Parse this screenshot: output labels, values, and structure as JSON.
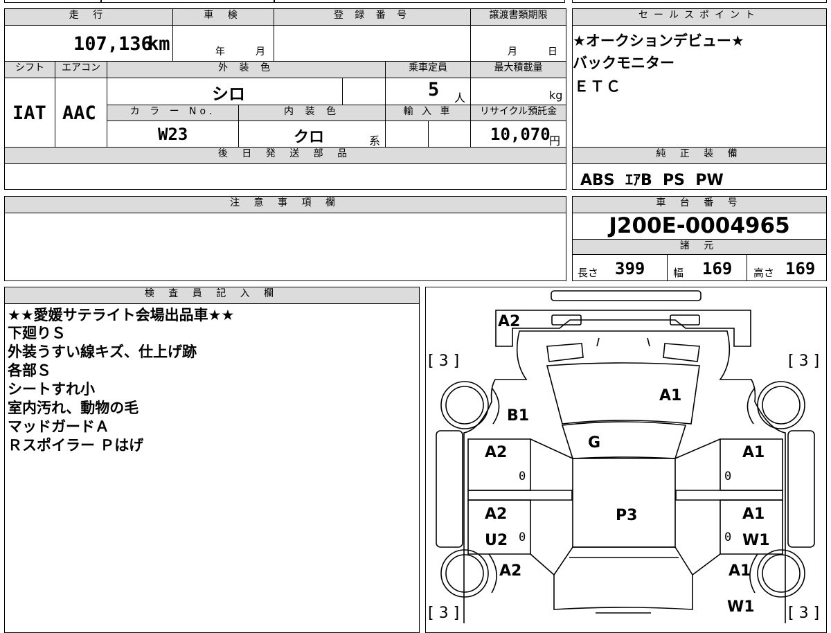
{
  "vehicle": {
    "mileage_label": "走 行",
    "mileage": "107,136",
    "mileage_unit": "km",
    "inspection_label": "車 検",
    "inspection_year": "年",
    "inspection_month": "月",
    "registration_label": "登 録 番 号",
    "transfer_label": "譲渡書類期限",
    "transfer_month": "月",
    "transfer_day": "日",
    "shift_label": "シフト",
    "shift": "IAT",
    "aircon_label": "エアコン",
    "aircon": "AAC",
    "exterior_color_label": "外 装 色",
    "exterior_color": "シロ",
    "capacity_label": "乗車定員",
    "capacity": "5",
    "capacity_unit": "人",
    "max_load_label": "最大積載量",
    "max_load_unit": "kg",
    "color_no_label": "カ ラ ー No.",
    "color_no": "W23",
    "interior_color_label": "内 装 色",
    "interior_color": "クロ",
    "interior_suffix": "系",
    "import_label": "輸 入 車",
    "recycle_label": "リサイクル預託金",
    "recycle_fee": "10,070",
    "recycle_unit": "円",
    "later_parts_label": "後 日 発 送 部 品"
  },
  "sales_points": {
    "label": "セールスポイント",
    "lines": [
      "★オークションデビュー★",
      "バックモニター",
      "ＥＴＣ"
    ]
  },
  "equipment": {
    "label": "純 正 装 備",
    "value": "ABS  ｴｱB  PS  PW"
  },
  "notes": {
    "label": "注 意 事 項 欄"
  },
  "chassis": {
    "label": "車 台 番 号",
    "number": "J200E-0004965",
    "specs_label": "諸 元",
    "length_label": "長さ",
    "length": "399",
    "width_label": "幅",
    "width": "169",
    "height_label": "高さ",
    "height": "169"
  },
  "inspector": {
    "label": "検 査 員 記 入 欄",
    "lines": [
      "★★愛媛サテライト会場出品車★★",
      "下廻りＳ",
      "外装うすい線キズ、仕上げ跡",
      "各部Ｓ",
      "シートすれ小",
      "室内汚れ、動物の毛",
      "マッドガードＡ",
      "Ｒスポイラー Ｐはげ"
    ]
  },
  "diagram": {
    "tire_marks": [
      "[ 3 ]",
      "[ 3 ]",
      "[ 3 ]",
      "[ 3 ]"
    ],
    "marks": {
      "front_bumper": "A2",
      "hood": "A1",
      "left_front_fender": "B1",
      "windshield": "G",
      "left_front_door": "A2",
      "right_front_door": "A1",
      "roof": "P3",
      "left_rear_door_1": "A2",
      "left_rear_door_2": "U2",
      "right_rear_door_1": "A1",
      "right_rear_door_2": "W1",
      "left_rear_fender": "A2",
      "right_rear_fender": "A1",
      "right_rear_quarter": "W1",
      "zero": "0"
    }
  }
}
